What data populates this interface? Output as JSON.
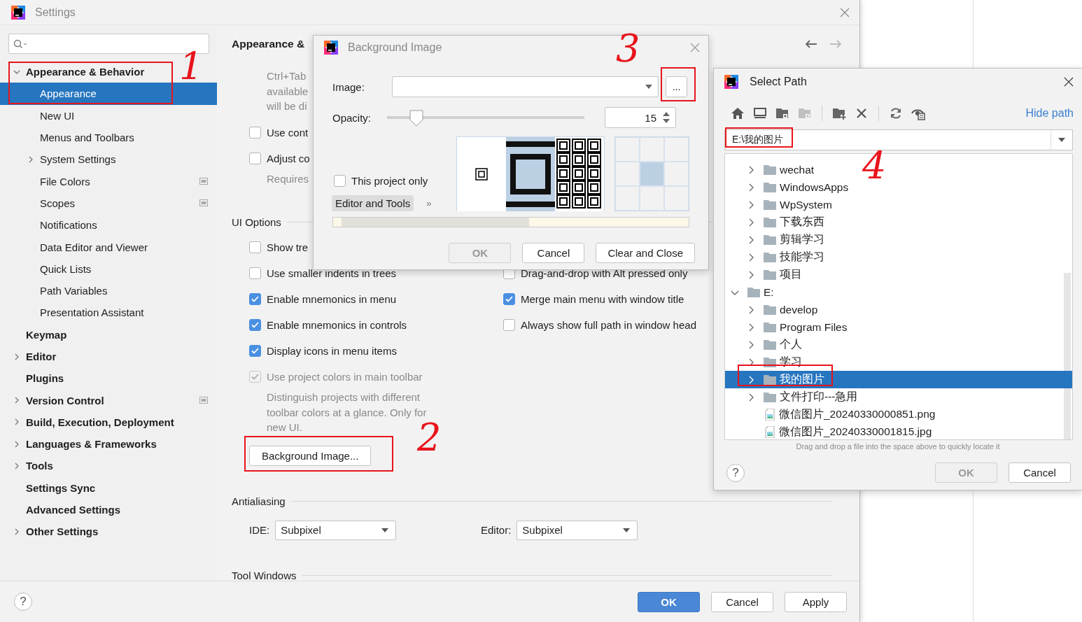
{
  "settings": {
    "title": "Settings",
    "sidebar": {
      "items": [
        {
          "label": "Appearance & Behavior",
          "selected": false,
          "expanded": true,
          "children": [
            {
              "label": "Appearance",
              "selected": true
            },
            {
              "label": "New UI",
              "selected": false
            },
            {
              "label": "Menus and Toolbars",
              "selected": false
            },
            {
              "label": "System Settings",
              "selected": false,
              "expanded": false
            },
            {
              "label": "File Colors",
              "selected": false,
              "project_scope": true
            },
            {
              "label": "Scopes",
              "selected": false,
              "project_scope": true
            },
            {
              "label": "Notifications",
              "selected": false
            },
            {
              "label": "Data Editor and Viewer",
              "selected": false
            },
            {
              "label": "Quick Lists",
              "selected": false
            },
            {
              "label": "Path Variables",
              "selected": false
            },
            {
              "label": "Presentation Assistant",
              "selected": false
            }
          ]
        },
        {
          "label": "Keymap",
          "selected": false
        },
        {
          "label": "Editor",
          "selected": false,
          "expanded": false
        },
        {
          "label": "Plugins",
          "selected": false
        },
        {
          "label": "Version Control",
          "selected": false,
          "expanded": false,
          "project_scope": true
        },
        {
          "label": "Build, Execution, Deployment",
          "selected": false,
          "expanded": false
        },
        {
          "label": "Languages & Frameworks",
          "selected": false,
          "expanded": false
        },
        {
          "label": "Tools",
          "selected": false,
          "expanded": false
        },
        {
          "label": "Settings Sync",
          "selected": false
        },
        {
          "label": "Advanced Settings",
          "selected": false
        },
        {
          "label": "Other Settings",
          "selected": false,
          "expanded": false
        }
      ]
    },
    "content": {
      "title": "Appearance &",
      "blocks": [
        {
          "kind": "note",
          "lines": [
            "Ctrl+Tab",
            "available",
            "will be di"
          ]
        },
        {
          "kind": "checks",
          "items": [
            {
              "label": "Use cont",
              "checked": false,
              "disabled": false
            }
          ]
        },
        {
          "kind": "checks",
          "items": [
            {
              "label": "Adjust co",
              "checked": false,
              "disabled": false
            }
          ]
        },
        {
          "kind": "note",
          "lines": [
            "Requires"
          ]
        },
        {
          "kind": "section",
          "label": "UI Options"
        },
        {
          "kind": "checks",
          "items": [
            {
              "label": "Show tre",
              "checked": false,
              "disabled": false
            }
          ]
        },
        {
          "kind": "checks",
          "items": [
            {
              "label": "Use smaller indents in trees",
              "checked": false,
              "disabled": false
            },
            {
              "label": "Drag-and-drop with Alt pressed only",
              "checked": false,
              "disabled": false
            }
          ]
        },
        {
          "kind": "checks",
          "items": [
            {
              "label": "Enable mnemonics in menu",
              "checked": true,
              "disabled": false
            },
            {
              "label": "Merge main menu with window title",
              "checked": true,
              "disabled": false
            }
          ]
        },
        {
          "kind": "checks",
          "items": [
            {
              "label": "Enable mnemonics in controls",
              "checked": true,
              "disabled": false
            },
            {
              "label": "Always show full path in window head",
              "checked": false,
              "disabled": false
            }
          ]
        },
        {
          "kind": "checks",
          "items": [
            {
              "label": "Display icons in menu items",
              "checked": true,
              "disabled": false
            }
          ]
        },
        {
          "kind": "checks",
          "items": [
            {
              "label": "Use project colors in main toolbar",
              "checked": true,
              "disabled": true
            }
          ]
        },
        {
          "kind": "note",
          "lines": [
            "Distinguish projects with different",
            "toolbar colors at a glance. Only for",
            "new UI."
          ]
        },
        {
          "kind": "button",
          "label": "Background Image..."
        },
        {
          "kind": "section",
          "label": "Antialiasing"
        },
        {
          "kind": "combos",
          "items": [
            {
              "label": "IDE:",
              "value": "Subpixel"
            },
            {
              "label": "Editor:",
              "value": "Subpixel"
            }
          ]
        },
        {
          "kind": "section",
          "label": "Tool Windows"
        }
      ]
    },
    "help": "?",
    "buttons": [
      {
        "label": "OK",
        "kind": "primary"
      },
      {
        "label": "Cancel",
        "kind": "normal"
      },
      {
        "label": "Apply",
        "kind": "normal"
      }
    ]
  },
  "background_dialog": {
    "title": "Background Image",
    "image_label": "Image:",
    "browse": "...",
    "opacity": {
      "label": "Opacity:",
      "level": 0.15,
      "value": "15"
    },
    "project_only": {
      "label": "This project only",
      "checked": false
    },
    "tabs": [
      {
        "label": "Editor and Tools",
        "selected": true
      }
    ],
    "more": "»",
    "fill_modes": [
      {
        "kind": "plain",
        "selected": false
      },
      {
        "kind": "scale",
        "selected": true
      },
      {
        "kind": "tile",
        "selected": false
      }
    ],
    "anchors": [
      {
        "selected": false
      },
      {
        "selected": false
      },
      {
        "selected": false
      },
      {
        "selected": false
      },
      {
        "selected": true
      },
      {
        "selected": false
      },
      {
        "selected": false
      },
      {
        "selected": false
      },
      {
        "selected": false
      }
    ],
    "buttons": [
      {
        "label": "OK",
        "disabled": true
      },
      {
        "label": "Cancel",
        "disabled": false
      },
      {
        "label": "Clear and Close",
        "disabled": false
      }
    ]
  },
  "select_path": {
    "title": "Select Path",
    "hide_path": "Hide path",
    "path": "E:\\我的图片",
    "toolbar": [
      [
        {
          "kind": "home",
          "disabled": false
        },
        {
          "kind": "desktop",
          "disabled": false
        },
        {
          "kind": "project",
          "disabled": false
        },
        {
          "kind": "module",
          "disabled": true
        }
      ],
      [
        {
          "kind": "new-folder",
          "disabled": false
        },
        {
          "kind": "delete",
          "disabled": false
        }
      ],
      [
        {
          "kind": "refresh",
          "disabled": false
        },
        {
          "kind": "show-hidden",
          "disabled": false
        }
      ]
    ],
    "tree": {
      "scrolled_items": [
        {
          "name": "wechat",
          "kind": "folder",
          "selected": false,
          "expanded": false
        },
        {
          "name": "WindowsApps",
          "kind": "folder",
          "selected": false,
          "expanded": false
        },
        {
          "name": "WpSystem",
          "kind": "folder",
          "selected": false,
          "expanded": false
        },
        {
          "name": "下载东西",
          "kind": "folder",
          "selected": false,
          "expanded": false
        },
        {
          "name": "剪辑学习",
          "kind": "folder",
          "selected": false,
          "expanded": false
        },
        {
          "name": "技能学习",
          "kind": "folder",
          "selected": false,
          "expanded": false
        },
        {
          "name": "项目",
          "kind": "folder",
          "selected": false,
          "expanded": false
        }
      ],
      "items": [
        {
          "name": "E:",
          "kind": "folder",
          "selected": false,
          "expanded": true,
          "children": [
            {
              "name": "develop",
              "kind": "folder",
              "selected": false,
              "expanded": false
            },
            {
              "name": "Program Files",
              "kind": "folder",
              "selected": false,
              "expanded": false
            },
            {
              "name": "个人",
              "kind": "folder",
              "selected": false,
              "expanded": false
            },
            {
              "name": "学习",
              "kind": "folder",
              "selected": false,
              "expanded": false
            },
            {
              "name": "我的图片",
              "kind": "folder",
              "selected": true,
              "expanded": false
            },
            {
              "name": "文件打印---急用",
              "kind": "folder",
              "selected": false,
              "expanded": false
            },
            {
              "name": "微信图片_20240330000851.png",
              "kind": "file",
              "selected": false
            },
            {
              "name": "微信图片_20240330001815.jpg",
              "kind": "file",
              "selected": false
            }
          ]
        }
      ]
    },
    "hint": "Drag and drop a file into the space above to quickly locate it",
    "help": "?",
    "buttons": [
      {
        "label": "OK",
        "disabled": true
      },
      {
        "label": "Cancel",
        "disabled": false
      }
    ]
  },
  "annotations": [
    {
      "label": "1"
    },
    {
      "label": "2"
    },
    {
      "label": "3"
    },
    {
      "label": "4"
    }
  ]
}
